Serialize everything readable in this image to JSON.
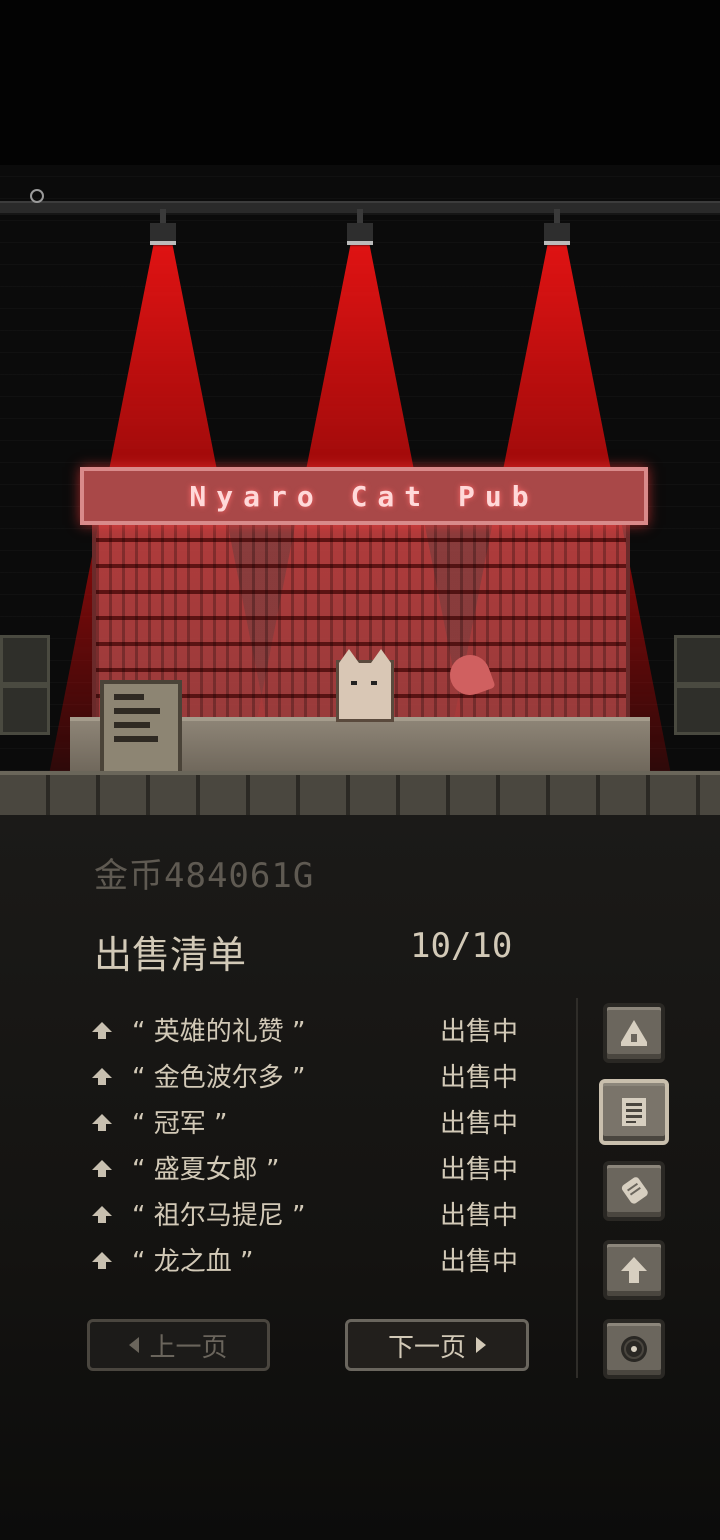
{
  "scene": {
    "pub_sign": "Nyaro Cat Pub"
  },
  "header": {
    "gold_label": "金币484061G"
  },
  "sell_list": {
    "title": "出售清单",
    "count": "10/10",
    "items": [
      {
        "name": "“ 英雄的礼赞 ”",
        "status": "出售中"
      },
      {
        "name": "“ 金色波尔多 ”",
        "status": "出售中"
      },
      {
        "name": "“ 冠军 ”",
        "status": "出售中"
      },
      {
        "name": "“ 盛夏女郎 ”",
        "status": "出售中"
      },
      {
        "name": "“ 祖尔马提尼 ”",
        "status": "出售中"
      },
      {
        "name": "“ 龙之血 ”",
        "status": "出售中"
      }
    ]
  },
  "pagination": {
    "prev_label": "上一页",
    "next_label": "下一页"
  },
  "side_tabs": [
    {
      "icon": "bar-icon",
      "active": false
    },
    {
      "icon": "list-icon",
      "active": true
    },
    {
      "icon": "scroll-icon",
      "active": false
    },
    {
      "icon": "upgrade-arrow-icon",
      "active": false
    },
    {
      "icon": "record-icon",
      "active": false
    }
  ],
  "colors": {
    "beam": "#e61414",
    "panel_bg": "#1b1a18",
    "text": "#d2c9b7",
    "muted": "#5f5a52"
  }
}
